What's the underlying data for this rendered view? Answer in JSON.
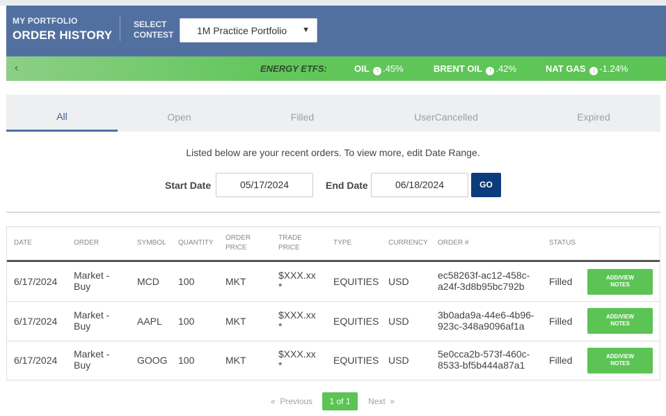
{
  "header": {
    "section": "MY PORTFOLIO",
    "title": "ORDER HISTORY",
    "select_label_line1": "SELECT",
    "select_label_line2": "CONTEST",
    "contest_value": "1M Practice Portfolio"
  },
  "ticker": {
    "category": "ENERGY ETFS:",
    "items": [
      {
        "name": "OIL",
        "direction": "up",
        "value": ".45%"
      },
      {
        "name": "BRENT OIL",
        "direction": "up",
        "value": ".42%"
      },
      {
        "name": "NAT GAS",
        "direction": "down",
        "value": "-1.24%"
      }
    ]
  },
  "tabs": [
    "All",
    "Open",
    "Filled",
    "UserCancelled",
    "Expired"
  ],
  "active_tab": "All",
  "info_text": "Listed below are your recent orders. To view more, edit Date Range.",
  "date_filter": {
    "start_label": "Start Date",
    "start_value": "05/17/2024",
    "end_label": "End Date",
    "end_value": "06/18/2024",
    "go_label": "GO"
  },
  "table": {
    "headers": {
      "date": "DATE",
      "order": "ORDER",
      "symbol": "SYMBOL",
      "quantity": "QUANTITY",
      "order_price_1": "ORDER",
      "order_price_2": "PRICE",
      "trade_price_1": "TRADE",
      "trade_price_2": "PRICE",
      "type": "TYPE",
      "currency": "CURRENCY",
      "order_num": "ORDER #",
      "status": "STATUS"
    },
    "rows": [
      {
        "date": "6/17/2024",
        "order_1": "Market -",
        "order_2": "Buy",
        "symbol": "MCD",
        "quantity": "100",
        "order_price": "MKT",
        "trade_price_1": "$XXX.xx",
        "trade_price_2": "*",
        "type": "EQUITIES",
        "currency": "USD",
        "order_num_1": "ec58263f-ac12-458c-",
        "order_num_2": "a24f-3d8b95bc792b",
        "status": "Filled",
        "notes_1": "ADD/VIEW",
        "notes_2": "NOTES"
      },
      {
        "date": "6/17/2024",
        "order_1": "Market -",
        "order_2": "Buy",
        "symbol": "AAPL",
        "quantity": "100",
        "order_price": "MKT",
        "trade_price_1": "$XXX.xx",
        "trade_price_2": "*",
        "type": "EQUITIES",
        "currency": "USD",
        "order_num_1": "3b0ada9a-44e6-4b96-",
        "order_num_2": "923c-348a9096af1a",
        "status": "Filled",
        "notes_1": "ADD/VIEW",
        "notes_2": "NOTES"
      },
      {
        "date": "6/17/2024",
        "order_1": "Market -",
        "order_2": "Buy",
        "symbol": "GOOG",
        "quantity": "100",
        "order_price": "MKT",
        "trade_price_1": "$XXX.xx",
        "trade_price_2": "*",
        "type": "EQUITIES",
        "currency": "USD",
        "order_num_1": "5e0cca2b-573f-460c-",
        "order_num_2": "8533-bf5b444a87a1",
        "status": "Filled",
        "notes_1": "ADD/VIEW",
        "notes_2": "NOTES"
      }
    ]
  },
  "pager": {
    "previous": "Previous",
    "current": "1 of 1",
    "next": "Next"
  },
  "icons": {
    "up": "arrow-up-circle-icon",
    "down": "arrow-down-circle-icon",
    "back": "chevron-left-icon",
    "caret": "caret-down-icon"
  },
  "colors": {
    "header_bg": "#52709f",
    "ticker_green": "#5cc455",
    "go_button": "#0d3c7c",
    "active_tab": "#3d5f91"
  }
}
